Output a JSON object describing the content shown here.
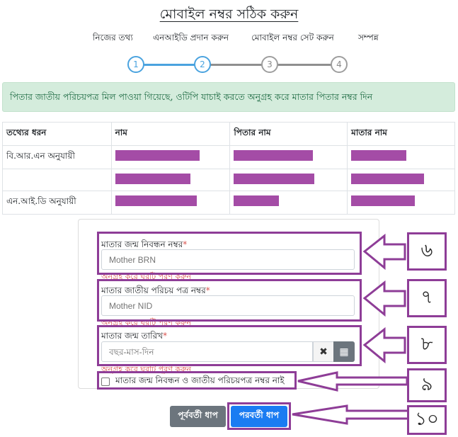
{
  "page": {
    "title": "মোবাইল নম্বর সঠিক করুন"
  },
  "steps": {
    "labels": [
      "নিজের তথ্য",
      "এনআইডি প্রদান করুন",
      "মোবাইল নম্বর সেট করুন",
      "সম্পন্ন"
    ],
    "numbers": [
      "1",
      "2",
      "3",
      "4"
    ]
  },
  "alert": {
    "message": "পিতার জাতীয় পরিচয়পত্র মিল পাওয়া গিয়েছে, ওটিপি যাচাই করতে অনুগ্রহ করে মাতার পিতার নম্বর দিন"
  },
  "table": {
    "headers": [
      "তথ্যের ধরন",
      "নাম",
      "পিতার নাম",
      "মাতার নাম"
    ],
    "rows": [
      {
        "type": "বি.আর.এন অনুযায়ী"
      },
      {
        "type": ""
      },
      {
        "type": "এন.আই.ডি অনুযায়ী"
      }
    ]
  },
  "form": {
    "mother_brn": {
      "label": "মাতার জন্ম নিবন্ধন নম্বর",
      "required": "*",
      "placeholder": "Mother BRN",
      "helper": "অনুগ্রহ করে ঘরটি পূরণ করুন"
    },
    "mother_nid": {
      "label": "মাতার জাতীয় পরিচয় পত্র নম্বর",
      "required": "*",
      "placeholder": "Mother NID",
      "helper": "অনুগ্রহ করে ঘরটি পূরণ করুন"
    },
    "mother_dob": {
      "label": "মাতার জন্ম তারিখ",
      "required": "*",
      "placeholder": "বছর-মাস-দিন",
      "helper": "অনুগ্রহ করে ঘরটি পূরণ করুন",
      "clear_glyph": "✖",
      "calendar_glyph": "▦"
    },
    "no_numbers_checkbox": {
      "label": "মাতার জন্ম নিবন্ধন ও জাতীয় পরিচয়পত্র নম্বর নাই"
    }
  },
  "buttons": {
    "prev": "পূর্ববর্তী ধাপ",
    "next": "পরবর্তী ধাপ"
  },
  "annotations": [
    "৬",
    "৭",
    "৮",
    "৯",
    "১০"
  ],
  "colors": {
    "highlight": "#8e3d97",
    "redaction": "#a44ca6",
    "step_active": "#4aa3df",
    "next_button": "#1a7cf2",
    "alert_bg": "#d4ecdc"
  }
}
